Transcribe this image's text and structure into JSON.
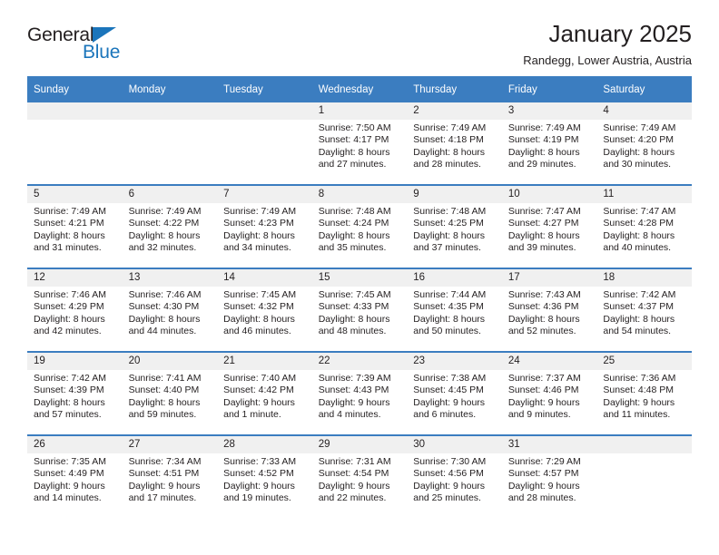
{
  "brand": {
    "word_one": "General",
    "word_two": "Blue",
    "triangle_icon": "triangle-icon",
    "accent_color": "#1b75bb"
  },
  "header": {
    "title": "January 2025",
    "subtitle": "Randegg, Lower Austria, Austria"
  },
  "theme": {
    "header_row_bg": "#3b7dc0",
    "daynum_bg": "#f0f0f0",
    "text_color": "#231f20"
  },
  "calendar": {
    "weekday_headers": [
      "Sunday",
      "Monday",
      "Tuesday",
      "Wednesday",
      "Thursday",
      "Friday",
      "Saturday"
    ],
    "labels": {
      "sunrise": "Sunrise:",
      "sunset": "Sunset:",
      "daylight": "Daylight:"
    },
    "weeks": [
      [
        {
          "day": "",
          "empty": true
        },
        {
          "day": "",
          "empty": true
        },
        {
          "day": "",
          "empty": true
        },
        {
          "day": "1",
          "sunrise": "Sunrise: 7:50 AM",
          "sunset": "Sunset: 4:17 PM",
          "daylight_1": "Daylight: 8 hours",
          "daylight_2": "and 27 minutes."
        },
        {
          "day": "2",
          "sunrise": "Sunrise: 7:49 AM",
          "sunset": "Sunset: 4:18 PM",
          "daylight_1": "Daylight: 8 hours",
          "daylight_2": "and 28 minutes."
        },
        {
          "day": "3",
          "sunrise": "Sunrise: 7:49 AM",
          "sunset": "Sunset: 4:19 PM",
          "daylight_1": "Daylight: 8 hours",
          "daylight_2": "and 29 minutes."
        },
        {
          "day": "4",
          "sunrise": "Sunrise: 7:49 AM",
          "sunset": "Sunset: 4:20 PM",
          "daylight_1": "Daylight: 8 hours",
          "daylight_2": "and 30 minutes."
        }
      ],
      [
        {
          "day": "5",
          "sunrise": "Sunrise: 7:49 AM",
          "sunset": "Sunset: 4:21 PM",
          "daylight_1": "Daylight: 8 hours",
          "daylight_2": "and 31 minutes."
        },
        {
          "day": "6",
          "sunrise": "Sunrise: 7:49 AM",
          "sunset": "Sunset: 4:22 PM",
          "daylight_1": "Daylight: 8 hours",
          "daylight_2": "and 32 minutes."
        },
        {
          "day": "7",
          "sunrise": "Sunrise: 7:49 AM",
          "sunset": "Sunset: 4:23 PM",
          "daylight_1": "Daylight: 8 hours",
          "daylight_2": "and 34 minutes."
        },
        {
          "day": "8",
          "sunrise": "Sunrise: 7:48 AM",
          "sunset": "Sunset: 4:24 PM",
          "daylight_1": "Daylight: 8 hours",
          "daylight_2": "and 35 minutes."
        },
        {
          "day": "9",
          "sunrise": "Sunrise: 7:48 AM",
          "sunset": "Sunset: 4:25 PM",
          "daylight_1": "Daylight: 8 hours",
          "daylight_2": "and 37 minutes."
        },
        {
          "day": "10",
          "sunrise": "Sunrise: 7:47 AM",
          "sunset": "Sunset: 4:27 PM",
          "daylight_1": "Daylight: 8 hours",
          "daylight_2": "and 39 minutes."
        },
        {
          "day": "11",
          "sunrise": "Sunrise: 7:47 AM",
          "sunset": "Sunset: 4:28 PM",
          "daylight_1": "Daylight: 8 hours",
          "daylight_2": "and 40 minutes."
        }
      ],
      [
        {
          "day": "12",
          "sunrise": "Sunrise: 7:46 AM",
          "sunset": "Sunset: 4:29 PM",
          "daylight_1": "Daylight: 8 hours",
          "daylight_2": "and 42 minutes."
        },
        {
          "day": "13",
          "sunrise": "Sunrise: 7:46 AM",
          "sunset": "Sunset: 4:30 PM",
          "daylight_1": "Daylight: 8 hours",
          "daylight_2": "and 44 minutes."
        },
        {
          "day": "14",
          "sunrise": "Sunrise: 7:45 AM",
          "sunset": "Sunset: 4:32 PM",
          "daylight_1": "Daylight: 8 hours",
          "daylight_2": "and 46 minutes."
        },
        {
          "day": "15",
          "sunrise": "Sunrise: 7:45 AM",
          "sunset": "Sunset: 4:33 PM",
          "daylight_1": "Daylight: 8 hours",
          "daylight_2": "and 48 minutes."
        },
        {
          "day": "16",
          "sunrise": "Sunrise: 7:44 AM",
          "sunset": "Sunset: 4:35 PM",
          "daylight_1": "Daylight: 8 hours",
          "daylight_2": "and 50 minutes."
        },
        {
          "day": "17",
          "sunrise": "Sunrise: 7:43 AM",
          "sunset": "Sunset: 4:36 PM",
          "daylight_1": "Daylight: 8 hours",
          "daylight_2": "and 52 minutes."
        },
        {
          "day": "18",
          "sunrise": "Sunrise: 7:42 AM",
          "sunset": "Sunset: 4:37 PM",
          "daylight_1": "Daylight: 8 hours",
          "daylight_2": "and 54 minutes."
        }
      ],
      [
        {
          "day": "19",
          "sunrise": "Sunrise: 7:42 AM",
          "sunset": "Sunset: 4:39 PM",
          "daylight_1": "Daylight: 8 hours",
          "daylight_2": "and 57 minutes."
        },
        {
          "day": "20",
          "sunrise": "Sunrise: 7:41 AM",
          "sunset": "Sunset: 4:40 PM",
          "daylight_1": "Daylight: 8 hours",
          "daylight_2": "and 59 minutes."
        },
        {
          "day": "21",
          "sunrise": "Sunrise: 7:40 AM",
          "sunset": "Sunset: 4:42 PM",
          "daylight_1": "Daylight: 9 hours",
          "daylight_2": "and 1 minute."
        },
        {
          "day": "22",
          "sunrise": "Sunrise: 7:39 AM",
          "sunset": "Sunset: 4:43 PM",
          "daylight_1": "Daylight: 9 hours",
          "daylight_2": "and 4 minutes."
        },
        {
          "day": "23",
          "sunrise": "Sunrise: 7:38 AM",
          "sunset": "Sunset: 4:45 PM",
          "daylight_1": "Daylight: 9 hours",
          "daylight_2": "and 6 minutes."
        },
        {
          "day": "24",
          "sunrise": "Sunrise: 7:37 AM",
          "sunset": "Sunset: 4:46 PM",
          "daylight_1": "Daylight: 9 hours",
          "daylight_2": "and 9 minutes."
        },
        {
          "day": "25",
          "sunrise": "Sunrise: 7:36 AM",
          "sunset": "Sunset: 4:48 PM",
          "daylight_1": "Daylight: 9 hours",
          "daylight_2": "and 11 minutes."
        }
      ],
      [
        {
          "day": "26",
          "sunrise": "Sunrise: 7:35 AM",
          "sunset": "Sunset: 4:49 PM",
          "daylight_1": "Daylight: 9 hours",
          "daylight_2": "and 14 minutes."
        },
        {
          "day": "27",
          "sunrise": "Sunrise: 7:34 AM",
          "sunset": "Sunset: 4:51 PM",
          "daylight_1": "Daylight: 9 hours",
          "daylight_2": "and 17 minutes."
        },
        {
          "day": "28",
          "sunrise": "Sunrise: 7:33 AM",
          "sunset": "Sunset: 4:52 PM",
          "daylight_1": "Daylight: 9 hours",
          "daylight_2": "and 19 minutes."
        },
        {
          "day": "29",
          "sunrise": "Sunrise: 7:31 AM",
          "sunset": "Sunset: 4:54 PM",
          "daylight_1": "Daylight: 9 hours",
          "daylight_2": "and 22 minutes."
        },
        {
          "day": "30",
          "sunrise": "Sunrise: 7:30 AM",
          "sunset": "Sunset: 4:56 PM",
          "daylight_1": "Daylight: 9 hours",
          "daylight_2": "and 25 minutes."
        },
        {
          "day": "31",
          "sunrise": "Sunrise: 7:29 AM",
          "sunset": "Sunset: 4:57 PM",
          "daylight_1": "Daylight: 9 hours",
          "daylight_2": "and 28 minutes."
        },
        {
          "day": "",
          "empty": true
        }
      ]
    ]
  }
}
